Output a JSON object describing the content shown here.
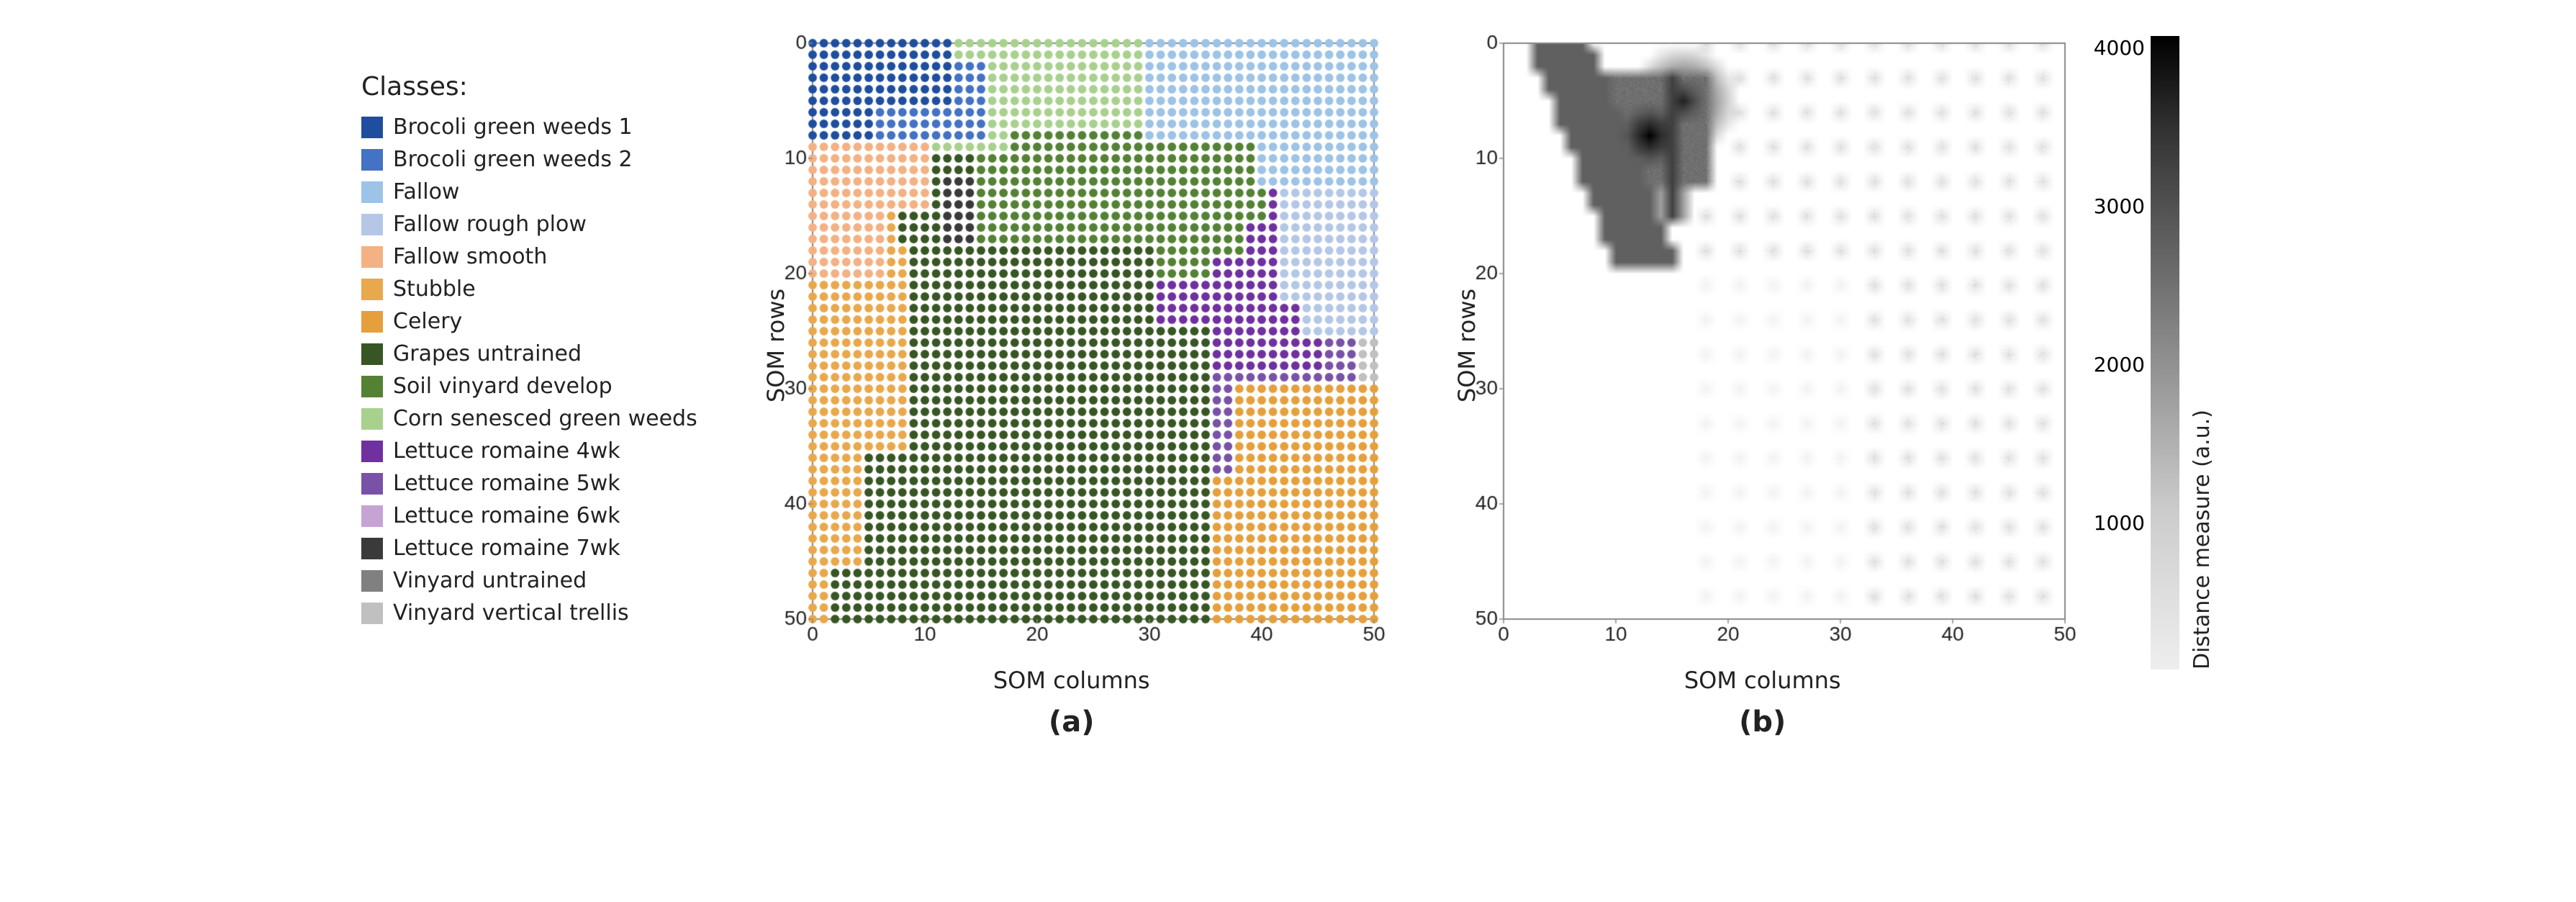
{
  "legend": {
    "title": "Classes:",
    "items": [
      {
        "label": "Brocoli green weeds 1",
        "color": "#1f4e9e"
      },
      {
        "label": "Brocoli green weeds 2",
        "color": "#4472c4"
      },
      {
        "label": "Fallow",
        "color": "#9dc3e6"
      },
      {
        "label": "Fallow rough plow",
        "color": "#b4c7e7"
      },
      {
        "label": "Fallow smooth",
        "color": "#f4b183"
      },
      {
        "label": "Stubble",
        "color": "#e9a84c"
      },
      {
        "label": "Celery",
        "color": "#e5a03d"
      },
      {
        "label": "Grapes untrained",
        "color": "#375623"
      },
      {
        "label": "Soil vinyard develop",
        "color": "#548235"
      },
      {
        "label": "Corn senesced green weeds",
        "color": "#a9d18e"
      },
      {
        "label": "Lettuce romaine 4wk",
        "color": "#7030a0"
      },
      {
        "label": "Lettuce romaine 5wk",
        "color": "#7952a8"
      },
      {
        "label": "Lettuce romaine 6wk",
        "color": "#c5a4d4"
      },
      {
        "label": "Lettuce romaine 7wk",
        "color": "#3a3a3a"
      },
      {
        "label": "Vinyard untrained",
        "color": "#808080"
      },
      {
        "label": "Vinyard vertical trellis",
        "color": "#c0c0c0"
      }
    ]
  },
  "chart_a": {
    "title": "",
    "x_label": "SOM columns",
    "y_label": "SOM rows",
    "figure_label": "(a)",
    "x_ticks": [
      0,
      10,
      20,
      30,
      40,
      50
    ],
    "y_ticks": [
      0,
      10,
      20,
      30,
      40,
      50
    ]
  },
  "chart_b": {
    "title": "",
    "x_label": "SOM columns",
    "y_label": "SOM rows",
    "figure_label": "(b)",
    "x_ticks": [
      0,
      10,
      20,
      30,
      40,
      50
    ],
    "y_ticks": [
      0,
      10,
      20,
      30,
      40,
      50
    ],
    "colorbar_ticks": [
      "4000",
      "3000",
      "2000",
      "1000",
      ""
    ],
    "colorbar_label": "Distance measure (a.u.)"
  }
}
